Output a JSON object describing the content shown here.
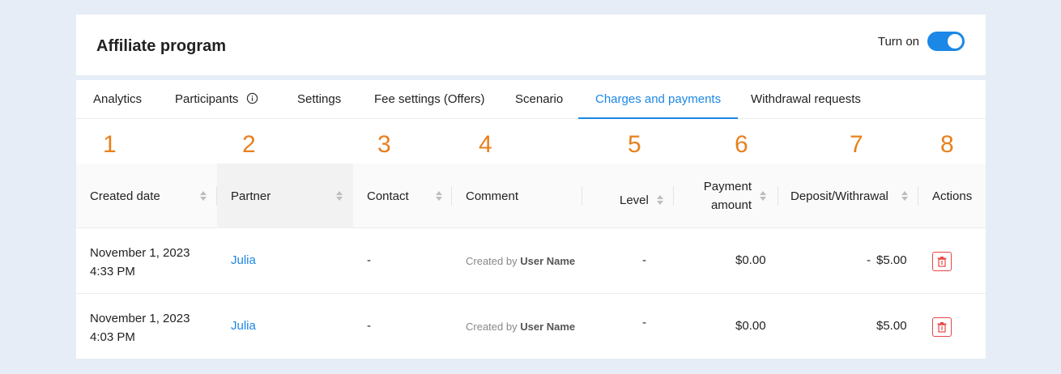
{
  "header": {
    "title": "Affiliate program",
    "toggle_label": "Turn on",
    "toggle_on": true
  },
  "tabs": [
    {
      "label": "Analytics"
    },
    {
      "label": "Participants"
    },
    {
      "label": "Settings"
    },
    {
      "label": "Fee settings (Offers)"
    },
    {
      "label": "Scenario"
    },
    {
      "label": "Charges and payments",
      "active": true
    },
    {
      "label": "Withdrawal requests"
    }
  ],
  "column_numbers": [
    "1",
    "2",
    "3",
    "4",
    "5",
    "6",
    "7",
    "8"
  ],
  "columns": {
    "created": "Created date",
    "partner": "Partner",
    "contact": "Contact",
    "comment": "Comment",
    "level": "Level",
    "payment_line1": "Payment",
    "payment_line2": "amount",
    "deposit": "Deposit/Withrawal",
    "actions": "Actions"
  },
  "rows": [
    {
      "date": "November 1, 2023",
      "time": "4:33 PM",
      "partner": "Julia",
      "contact": "-",
      "comment_prefix": "Created by",
      "comment_user": "User Name",
      "level": "-",
      "payment": "$0.00",
      "deposit_sign": "-",
      "deposit": "$5.00"
    },
    {
      "date": "November 1, 2023",
      "time": "4:03 PM",
      "partner": "Julia",
      "contact": "-",
      "comment_prefix": "Created by",
      "comment_user": "User Name",
      "level": "-",
      "payment": "$0.00",
      "deposit_sign": "",
      "deposit": "$5.00"
    }
  ],
  "colors": {
    "accent": "#1b87e6",
    "number": "#e8801e",
    "danger": "#e84545",
    "background": "#e6edf6"
  }
}
